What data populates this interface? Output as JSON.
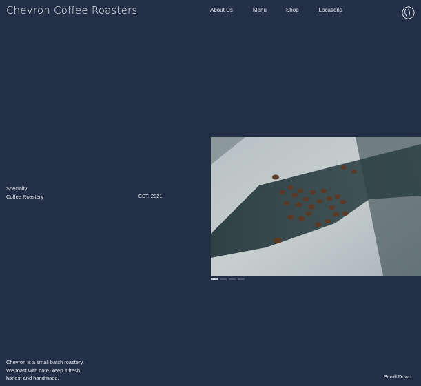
{
  "brand": "Chevron Coffee Roasters",
  "nav": [
    "About Us",
    "Menu",
    "Shop",
    "Locations"
  ],
  "hero": {
    "tag_line1": "Specialty",
    "tag_line2": "Coffee Roastery",
    "est": "EST. 2021"
  },
  "about": {
    "line1": "Chevron is a small batch roastery.",
    "line2": "We roast with care, keep it fresh,",
    "line3": "honest and handmade."
  },
  "scroll_label": "Scroll Down",
  "colors": {
    "background": "#232e47",
    "text": "#e9ebf0"
  },
  "icons": {
    "logo": "chevron-circle-logo-icon"
  }
}
